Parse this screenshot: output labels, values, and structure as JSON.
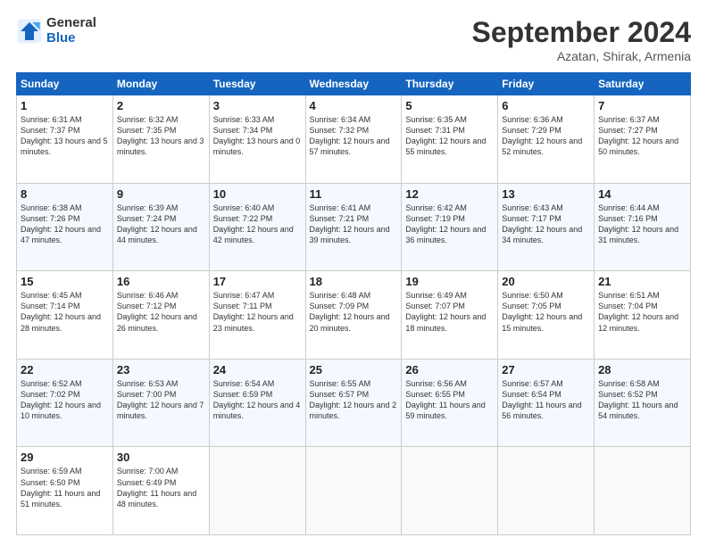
{
  "logo": {
    "general": "General",
    "blue": "Blue"
  },
  "header": {
    "month": "September 2024",
    "location": "Azatan, Shirak, Armenia"
  },
  "weekdays": [
    "Sunday",
    "Monday",
    "Tuesday",
    "Wednesday",
    "Thursday",
    "Friday",
    "Saturday"
  ],
  "weeks": [
    [
      {
        "day": "1",
        "sunrise": "Sunrise: 6:31 AM",
        "sunset": "Sunset: 7:37 PM",
        "daylight": "Daylight: 13 hours and 5 minutes."
      },
      {
        "day": "2",
        "sunrise": "Sunrise: 6:32 AM",
        "sunset": "Sunset: 7:35 PM",
        "daylight": "Daylight: 13 hours and 3 minutes."
      },
      {
        "day": "3",
        "sunrise": "Sunrise: 6:33 AM",
        "sunset": "Sunset: 7:34 PM",
        "daylight": "Daylight: 13 hours and 0 minutes."
      },
      {
        "day": "4",
        "sunrise": "Sunrise: 6:34 AM",
        "sunset": "Sunset: 7:32 PM",
        "daylight": "Daylight: 12 hours and 57 minutes."
      },
      {
        "day": "5",
        "sunrise": "Sunrise: 6:35 AM",
        "sunset": "Sunset: 7:31 PM",
        "daylight": "Daylight: 12 hours and 55 minutes."
      },
      {
        "day": "6",
        "sunrise": "Sunrise: 6:36 AM",
        "sunset": "Sunset: 7:29 PM",
        "daylight": "Daylight: 12 hours and 52 minutes."
      },
      {
        "day": "7",
        "sunrise": "Sunrise: 6:37 AM",
        "sunset": "Sunset: 7:27 PM",
        "daylight": "Daylight: 12 hours and 50 minutes."
      }
    ],
    [
      {
        "day": "8",
        "sunrise": "Sunrise: 6:38 AM",
        "sunset": "Sunset: 7:26 PM",
        "daylight": "Daylight: 12 hours and 47 minutes."
      },
      {
        "day": "9",
        "sunrise": "Sunrise: 6:39 AM",
        "sunset": "Sunset: 7:24 PM",
        "daylight": "Daylight: 12 hours and 44 minutes."
      },
      {
        "day": "10",
        "sunrise": "Sunrise: 6:40 AM",
        "sunset": "Sunset: 7:22 PM",
        "daylight": "Daylight: 12 hours and 42 minutes."
      },
      {
        "day": "11",
        "sunrise": "Sunrise: 6:41 AM",
        "sunset": "Sunset: 7:21 PM",
        "daylight": "Daylight: 12 hours and 39 minutes."
      },
      {
        "day": "12",
        "sunrise": "Sunrise: 6:42 AM",
        "sunset": "Sunset: 7:19 PM",
        "daylight": "Daylight: 12 hours and 36 minutes."
      },
      {
        "day": "13",
        "sunrise": "Sunrise: 6:43 AM",
        "sunset": "Sunset: 7:17 PM",
        "daylight": "Daylight: 12 hours and 34 minutes."
      },
      {
        "day": "14",
        "sunrise": "Sunrise: 6:44 AM",
        "sunset": "Sunset: 7:16 PM",
        "daylight": "Daylight: 12 hours and 31 minutes."
      }
    ],
    [
      {
        "day": "15",
        "sunrise": "Sunrise: 6:45 AM",
        "sunset": "Sunset: 7:14 PM",
        "daylight": "Daylight: 12 hours and 28 minutes."
      },
      {
        "day": "16",
        "sunrise": "Sunrise: 6:46 AM",
        "sunset": "Sunset: 7:12 PM",
        "daylight": "Daylight: 12 hours and 26 minutes."
      },
      {
        "day": "17",
        "sunrise": "Sunrise: 6:47 AM",
        "sunset": "Sunset: 7:11 PM",
        "daylight": "Daylight: 12 hours and 23 minutes."
      },
      {
        "day": "18",
        "sunrise": "Sunrise: 6:48 AM",
        "sunset": "Sunset: 7:09 PM",
        "daylight": "Daylight: 12 hours and 20 minutes."
      },
      {
        "day": "19",
        "sunrise": "Sunrise: 6:49 AM",
        "sunset": "Sunset: 7:07 PM",
        "daylight": "Daylight: 12 hours and 18 minutes."
      },
      {
        "day": "20",
        "sunrise": "Sunrise: 6:50 AM",
        "sunset": "Sunset: 7:05 PM",
        "daylight": "Daylight: 12 hours and 15 minutes."
      },
      {
        "day": "21",
        "sunrise": "Sunrise: 6:51 AM",
        "sunset": "Sunset: 7:04 PM",
        "daylight": "Daylight: 12 hours and 12 minutes."
      }
    ],
    [
      {
        "day": "22",
        "sunrise": "Sunrise: 6:52 AM",
        "sunset": "Sunset: 7:02 PM",
        "daylight": "Daylight: 12 hours and 10 minutes."
      },
      {
        "day": "23",
        "sunrise": "Sunrise: 6:53 AM",
        "sunset": "Sunset: 7:00 PM",
        "daylight": "Daylight: 12 hours and 7 minutes."
      },
      {
        "day": "24",
        "sunrise": "Sunrise: 6:54 AM",
        "sunset": "Sunset: 6:59 PM",
        "daylight": "Daylight: 12 hours and 4 minutes."
      },
      {
        "day": "25",
        "sunrise": "Sunrise: 6:55 AM",
        "sunset": "Sunset: 6:57 PM",
        "daylight": "Daylight: 12 hours and 2 minutes."
      },
      {
        "day": "26",
        "sunrise": "Sunrise: 6:56 AM",
        "sunset": "Sunset: 6:55 PM",
        "daylight": "Daylight: 11 hours and 59 minutes."
      },
      {
        "day": "27",
        "sunrise": "Sunrise: 6:57 AM",
        "sunset": "Sunset: 6:54 PM",
        "daylight": "Daylight: 11 hours and 56 minutes."
      },
      {
        "day": "28",
        "sunrise": "Sunrise: 6:58 AM",
        "sunset": "Sunset: 6:52 PM",
        "daylight": "Daylight: 11 hours and 54 minutes."
      }
    ],
    [
      {
        "day": "29",
        "sunrise": "Sunrise: 6:59 AM",
        "sunset": "Sunset: 6:50 PM",
        "daylight": "Daylight: 11 hours and 51 minutes."
      },
      {
        "day": "30",
        "sunrise": "Sunrise: 7:00 AM",
        "sunset": "Sunset: 6:49 PM",
        "daylight": "Daylight: 11 hours and 48 minutes."
      },
      null,
      null,
      null,
      null,
      null
    ]
  ]
}
